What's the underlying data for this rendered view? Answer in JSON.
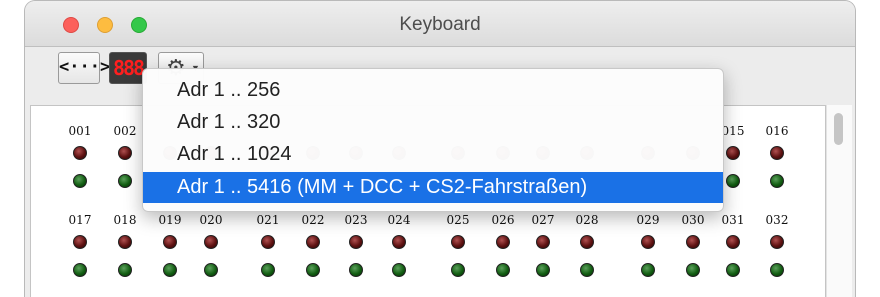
{
  "window": {
    "title": "Keyboard"
  },
  "toolbar": {
    "code_label": "<···>",
    "led_label": "888",
    "gear_icon": "gear-icon",
    "chevron_icon": "chevron-down-icon"
  },
  "menu": {
    "items": [
      {
        "label": "Adr 1 .. 256",
        "selected": false
      },
      {
        "label": "Adr 1 .. 320",
        "selected": false
      },
      {
        "label": "Adr 1 .. 1024",
        "selected": false
      },
      {
        "label": "Adr 1 ..  5416 (MM + DCC + CS2-Fahrstraßen)",
        "selected": true
      }
    ],
    "highlight_color": "#1a71e6"
  },
  "keyboard": {
    "row1_visible_labels": [
      "001",
      "002",
      "015",
      "016"
    ],
    "row2_labels": [
      "017",
      "018",
      "019",
      "020",
      "021",
      "022",
      "023",
      "024",
      "025",
      "026",
      "027",
      "028",
      "029",
      "030",
      "031",
      "032"
    ],
    "led_colors": {
      "red": "#5e1212",
      "green": "#135e13"
    }
  }
}
